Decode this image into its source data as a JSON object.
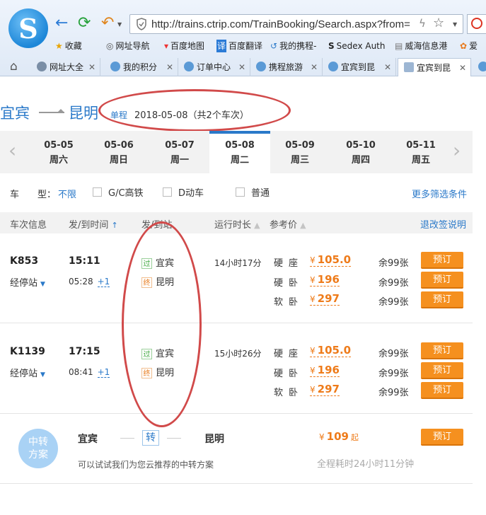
{
  "browser": {
    "logo": "S",
    "url": "http://trains.ctrip.com/TrainBooking/Search.aspx?from=",
    "bookmarks": [
      {
        "icon": "star-icon",
        "label": "收藏"
      },
      {
        "icon": "globe-icon",
        "label": "网址导航"
      },
      {
        "icon": "map-pin-icon",
        "label": "百度地图"
      },
      {
        "icon": "translate-icon",
        "label": "百度翻译"
      },
      {
        "icon": "ctrip-icon",
        "label": "我的携程-"
      },
      {
        "icon": "sedex-icon",
        "label": "Sedex Auth"
      },
      {
        "icon": "doc-icon",
        "label": "威海信息港"
      },
      {
        "icon": "flower-icon",
        "label": "爱"
      }
    ],
    "tabs": [
      {
        "label": "网址大全"
      },
      {
        "label": "我的积分"
      },
      {
        "label": "订单中心"
      },
      {
        "label": "携程旅游"
      },
      {
        "label": "宜宾到昆"
      },
      {
        "label": "宜宾到昆",
        "active": true
      }
    ]
  },
  "route": {
    "from": "宜宾",
    "to": "昆明",
    "trip_type": "单程",
    "summary": "2018-05-08（共2个车次）"
  },
  "dates": [
    {
      "date": "05-05",
      "weekday": "周六"
    },
    {
      "date": "05-06",
      "weekday": "周日"
    },
    {
      "date": "05-07",
      "weekday": "周一"
    },
    {
      "date": "05-08",
      "weekday": "周二",
      "active": true
    },
    {
      "date": "05-09",
      "weekday": "周三"
    },
    {
      "date": "05-10",
      "weekday": "周四"
    },
    {
      "date": "05-11",
      "weekday": "周五"
    }
  ],
  "filters": {
    "label": "车　　型：",
    "all": "不限",
    "options": [
      "G/C高铁",
      "D动车",
      "普通"
    ],
    "more": "更多筛选条件"
  },
  "table_header": {
    "train_info": "车次信息",
    "dep_arr_time": "发/到时间",
    "dep_arr_station": "发/到站",
    "duration": "运行时长",
    "ref_price": "参考价",
    "refund": "退改签说明"
  },
  "trains": [
    {
      "number": "K853",
      "stops": "经停站",
      "dep_time": "15:11",
      "arr_time": "05:28",
      "arr_plus": "+1",
      "pass_tag": "过",
      "from_station": "宜宾",
      "end_tag": "终",
      "to_station": "昆明",
      "duration": "14小时17分",
      "seats": [
        {
          "name": "硬座",
          "currency": "¥",
          "price": "105.0",
          "left": "余99张",
          "book": "预订"
        },
        {
          "name": "硬卧",
          "currency": "¥",
          "price": "196",
          "left": "余99张",
          "book": "预订"
        },
        {
          "name": "软卧",
          "currency": "¥",
          "price": "297",
          "left": "余99张",
          "book": "预订"
        }
      ]
    },
    {
      "number": "K1139",
      "stops": "经停站",
      "dep_time": "17:15",
      "arr_time": "08:41",
      "arr_plus": "+1",
      "pass_tag": "过",
      "from_station": "宜宾",
      "end_tag": "终",
      "to_station": "昆明",
      "duration": "15小时26分",
      "seats": [
        {
          "name": "硬座",
          "currency": "¥",
          "price": "105.0",
          "left": "余99张",
          "book": "预订"
        },
        {
          "name": "硬卧",
          "currency": "¥",
          "price": "196",
          "left": "余99张",
          "book": "预订"
        },
        {
          "name": "软卧",
          "currency": "¥",
          "price": "297",
          "left": "余99张",
          "book": "预订"
        }
      ]
    }
  ],
  "transfer": {
    "badge_line1": "中转",
    "badge_line2": "方案",
    "from": "宜宾",
    "zhuan": "转",
    "to": "昆明",
    "currency": "¥",
    "price": "109",
    "qi": "起",
    "book": "预订",
    "hint": "可以试试我们为您云推荐的中转方案",
    "total_time": "全程耗时24小时11分钟"
  },
  "annotation_color": "#d14a4a"
}
